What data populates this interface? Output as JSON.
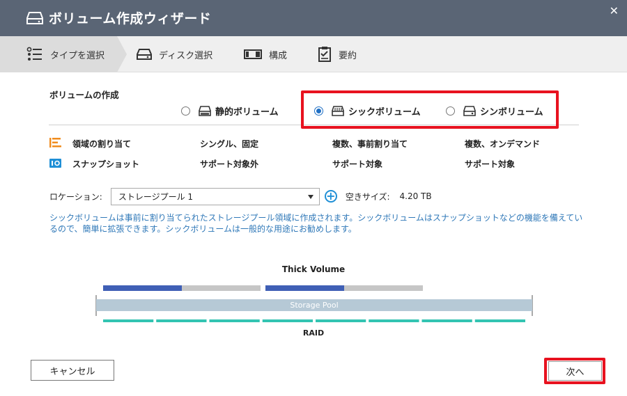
{
  "window": {
    "title": "ボリューム作成ウィザード",
    "close_glyph": "✕"
  },
  "steps": [
    {
      "label": "タイプを選択",
      "icon": "list-icon",
      "active": true
    },
    {
      "label": "ディスク選択",
      "icon": "disk-icon"
    },
    {
      "label": "構成",
      "icon": "config-icon"
    },
    {
      "label": "要約",
      "icon": "summary-icon"
    }
  ],
  "section": {
    "title": "ボリュームの作成"
  },
  "volume_types": [
    {
      "label": "静的ボリューム",
      "selected": false
    },
    {
      "label": "シックボリューム",
      "selected": true
    },
    {
      "label": "シンボリューム",
      "selected": false
    }
  ],
  "features": [
    {
      "name": "領域の割り当て",
      "icon": "allocation-icon",
      "icon_color": "#f08c1e",
      "values": [
        "シングル、固定",
        "複数、事前割り当て",
        "複数、オンデマンド"
      ]
    },
    {
      "name": "スナップショット",
      "icon": "snapshot-icon",
      "icon_color": "#1f8fd6",
      "values": [
        "サポート対象外",
        "サポート対象",
        "サポート対象"
      ]
    }
  ],
  "location": {
    "label": "ロケーション:",
    "value": "ストレージプール 1",
    "free_label": "空きサイズ:",
    "free_value": "4.20 TB"
  },
  "description": "シックボリュームは事前に割り当てられたストレージプール領域に作成されます。シックボリュームはスナップショットなどの機能を備えているので、簡単に拡張できます。シックボリュームは一般的な用途にお勧めします。",
  "diagram": {
    "title": "Thick Volume",
    "pool_label": "Storage Pool",
    "raid_label": "RAID",
    "volumes": [
      {
        "allocated_fraction": 0.5
      },
      {
        "allocated_fraction": 0.5
      }
    ],
    "raid_segments": 8,
    "colors": {
      "allocated": "#3f5fb5",
      "free": "#c6c6c6",
      "pool": "#b6c9d6",
      "raid": "#33c4b2"
    }
  },
  "buttons": {
    "cancel": "キャンセル",
    "next": "次へ"
  },
  "highlight_color": "#e8121f"
}
